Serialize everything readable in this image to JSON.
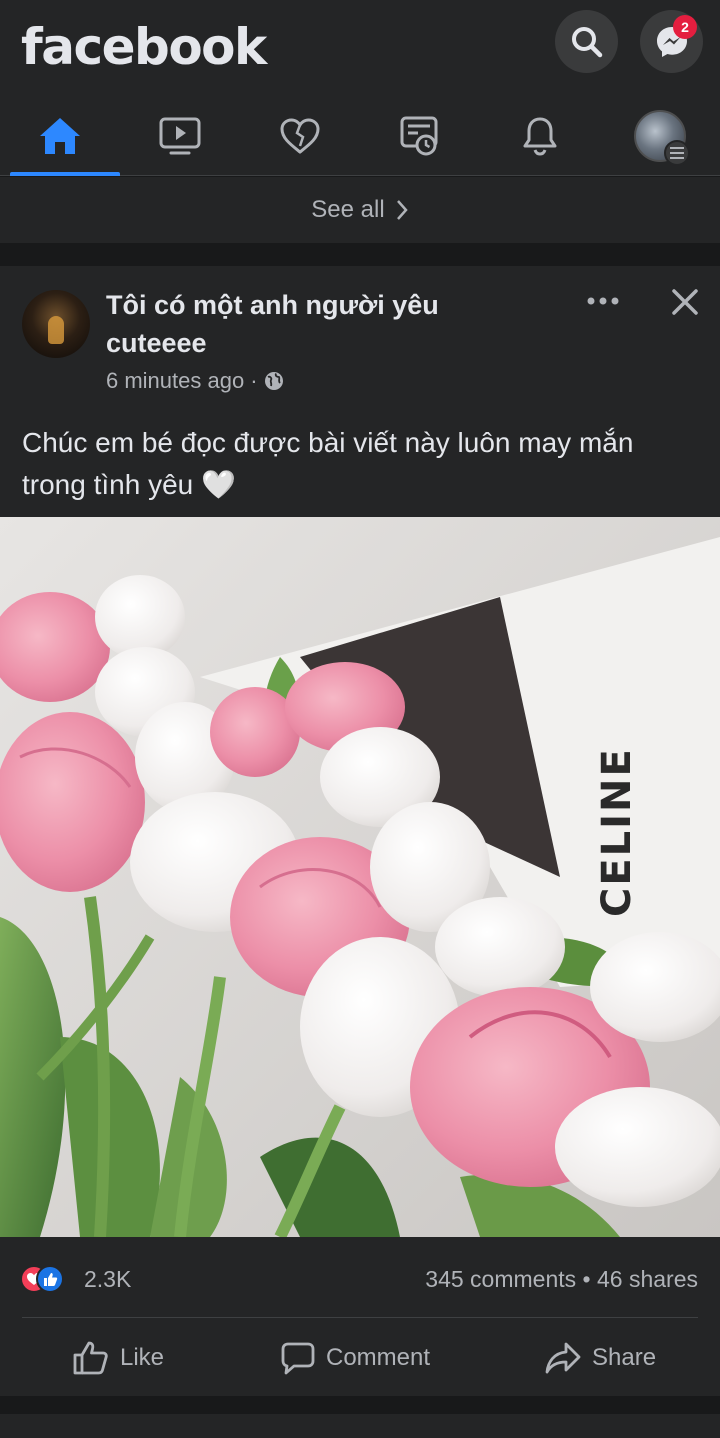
{
  "header": {
    "logo": "facebook",
    "search_icon": "search-icon",
    "messenger_icon": "messenger-icon",
    "messenger_badge": "2"
  },
  "tabs": [
    {
      "name": "home",
      "icon": "home-icon",
      "active": true
    },
    {
      "name": "watch",
      "icon": "video-icon",
      "active": false
    },
    {
      "name": "dating",
      "icon": "heart-icon",
      "active": false
    },
    {
      "name": "news",
      "icon": "news-icon",
      "active": false
    },
    {
      "name": "notifications",
      "icon": "bell-icon",
      "active": false
    },
    {
      "name": "menu",
      "icon": "profile-avatar-icon",
      "active": false
    }
  ],
  "see_all": {
    "label": "See all"
  },
  "post": {
    "author": "Tôi có một anh người yêu cuteeee",
    "time": "6 minutes ago",
    "separator": "·",
    "audience_icon": "globe-icon",
    "text": "Chúc em bé đọc được bài viết này luôn may mắn trong tình yêu",
    "text_emoji": "🤍",
    "photo_caption_text": "CELINE",
    "reaction_count": "2.3K",
    "comments": "345 comments",
    "stat_separator": "•",
    "shares": "46 shares",
    "actions": {
      "like": "Like",
      "comment": "Comment",
      "share": "Share"
    }
  },
  "colors": {
    "background": "#18191a",
    "surface": "#242526",
    "accent": "#2d88ff",
    "badge": "#e41e3f",
    "text_primary": "#e4e6eb",
    "text_secondary": "#b0b3b8"
  }
}
